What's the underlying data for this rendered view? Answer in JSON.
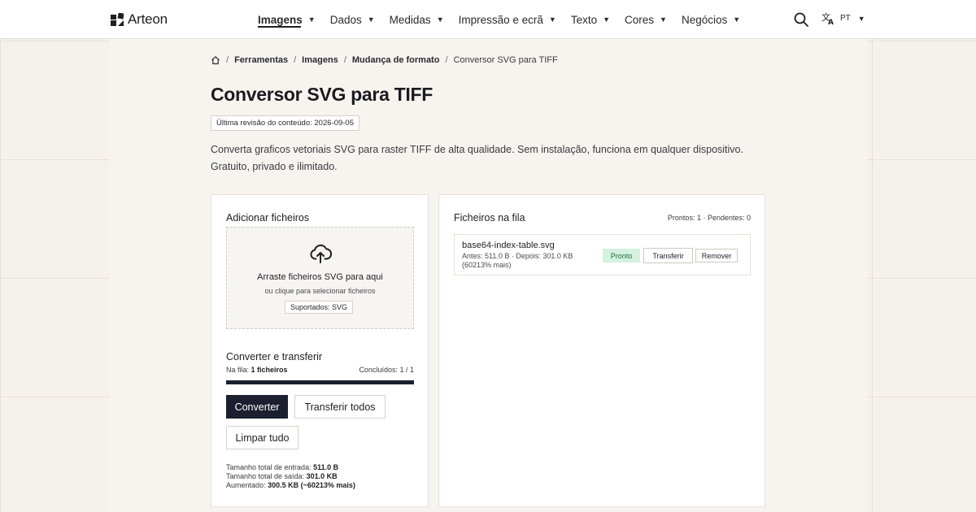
{
  "brand": {
    "name": "Arteon"
  },
  "nav": {
    "items": [
      {
        "label": "Imagens",
        "active": true
      },
      {
        "label": "Dados"
      },
      {
        "label": "Medidas"
      },
      {
        "label": "Impressão e ecrã"
      },
      {
        "label": "Texto"
      },
      {
        "label": "Cores"
      },
      {
        "label": "Negócios"
      }
    ],
    "caret": "▼",
    "search_icon": "search-icon",
    "language": {
      "icon": "translate-icon",
      "code": "PT"
    }
  },
  "breadcrumb": {
    "home_icon": "home-icon",
    "separator": "/",
    "items": [
      "Ferramentas",
      "Imagens",
      "Mudança de formato"
    ],
    "current": "Conversor SVG para TIFF"
  },
  "page": {
    "title": "Conversor SVG para TIFF",
    "revision": "Última revisão do conteúdo: 2026-09-05",
    "description": "Converta graficos vetoriais SVG para raster TIFF de alta qualidade. Sem instalação, funciona em qualquer dispositivo. Gratuito, privado e ilimitado."
  },
  "upload": {
    "title": "Adicionar ficheiros",
    "drop_main": "Arraste ficheiros SVG para aqui",
    "drop_sub": "ou clique para selecionar ficheiros",
    "supported": "Suportados: SVG",
    "icon": "cloud-upload-icon"
  },
  "convert": {
    "title": "Converter e transferir",
    "queue_label": "Na fila:",
    "queue_value": "1 ficheiros",
    "done_label": "Concluídos:",
    "done_value": "1 / 1",
    "progress": 1.0,
    "convert_button": "Converter",
    "transfer_all_button": "Transferir todos",
    "clear_button": "Limpar tudo",
    "totals": {
      "input_label": "Tamanho total de entrada:",
      "input_value": "511.0 B",
      "output_label": "Tamanho total de saída:",
      "output_value": "301.0 KB",
      "increase_label": "Aumentado:",
      "increase_value": "300.5 KB (~60213% mais)"
    }
  },
  "queue": {
    "title": "Ficheiros na fila",
    "counts": "Prontos: 1 · Pendentes: 0",
    "files": [
      {
        "name": "base64-index-table.svg",
        "sizes_line1": "Antes: 511.0 B · Depois: 301.0 KB",
        "sizes_line2": "(60213% mais)",
        "status": "Pronto",
        "transfer_button": "Transferir",
        "remove_button": "Remover"
      }
    ]
  },
  "colors": {
    "primary": "#1c1f2e",
    "status_ready_bg": "#d4f2df",
    "status_ready_text": "#1f6b3c",
    "page_bg": "#f5f1ec"
  }
}
